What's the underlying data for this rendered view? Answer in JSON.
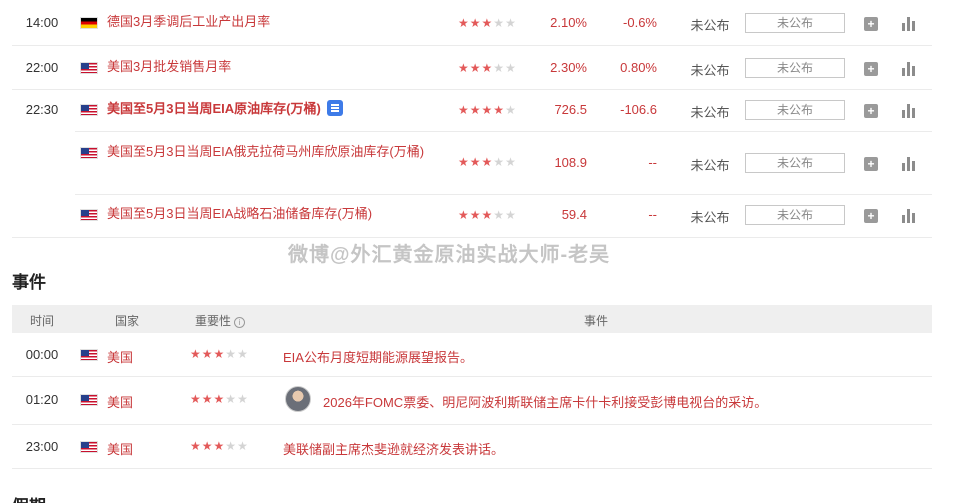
{
  "indicators": [
    {
      "time": "14:00",
      "flag": "de",
      "name": "德国3月季调后工业产出月率",
      "stars": 3,
      "forecast": "2.10%",
      "previous": "-0.6%",
      "actual_text": "未公布",
      "actual_box": "未公布"
    },
    {
      "time": "22:00",
      "flag": "us",
      "name": "美国3月批发销售月率",
      "stars": 3,
      "forecast": "2.30%",
      "previous": "0.80%",
      "actual_text": "未公布",
      "actual_box": "未公布"
    },
    {
      "time": "22:30",
      "flag": "us",
      "name": "美国至5月3日当周EIA原油库存(万桶)",
      "stars": 4,
      "forecast": "726.5",
      "previous": "-106.6",
      "actual_text": "未公布",
      "actual_box": "未公布"
    },
    {
      "time": "",
      "flag": "us",
      "name": "美国至5月3日当周EIA俄克拉荷马州库欣原油库存(万桶)",
      "stars": 3,
      "forecast": "108.9",
      "previous": "--",
      "actual_text": "未公布",
      "actual_box": "未公布"
    },
    {
      "time": "",
      "flag": "us",
      "name": "美国至5月3日当周EIA战略石油储备库存(万桶)",
      "stars": 3,
      "forecast": "59.4",
      "previous": "--",
      "actual_text": "未公布",
      "actual_box": "未公布"
    }
  ],
  "watermark": "微博@外汇黄金原油实战大师-老吴",
  "events": {
    "title": "事件",
    "headers": {
      "time": "时间",
      "country": "国家",
      "importance": "重要性",
      "event": "事件"
    },
    "rows": [
      {
        "time": "00:00",
        "country": "美国",
        "stars": 3,
        "text": "EIA公布月度短期能源展望报告。"
      },
      {
        "time": "01:20",
        "country": "美国",
        "stars": 3,
        "text": "2026年FOMC票委、明尼阿波利斯联储主席卡什卡利接受彭博电视台的采访。"
      },
      {
        "time": "23:00",
        "country": "美国",
        "stars": 3,
        "text": "美联储副主席杰斐逊就经济发表讲话。"
      }
    ]
  },
  "next_section_title": "假期",
  "plus_label": "+",
  "info_label": "i",
  "colors": {
    "accent_red": "#c8383a",
    "star_on": "#e35a5a",
    "star_off": "#d4d4d4",
    "header_bg": "#efefef"
  },
  "icons": {
    "add": "plus-icon",
    "chart": "bar-chart-icon",
    "doc": "document-icon",
    "info": "info-icon"
  }
}
